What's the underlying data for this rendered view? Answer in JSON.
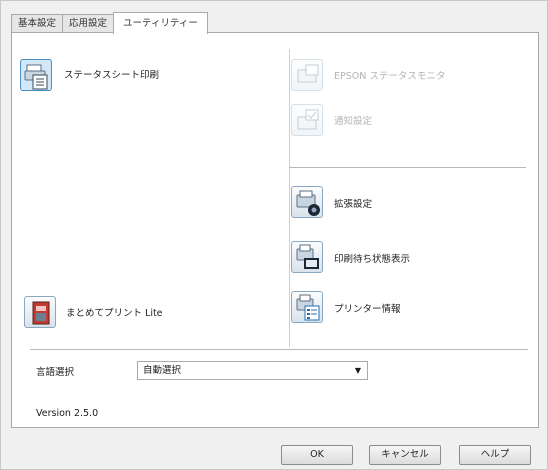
{
  "tabs": [
    {
      "label": "基本設定"
    },
    {
      "label": "応用設定"
    },
    {
      "label": "ユーティリティー"
    }
  ],
  "left_items": {
    "status_sheet": {
      "label": "ステータスシート印刷",
      "icon": "status-sheet-icon"
    },
    "matomete": {
      "label": "まとめてプリント Lite",
      "icon": "matomete-print-icon"
    }
  },
  "right_items": {
    "status_monitor": {
      "label": "EPSON ステータスモニタ",
      "icon": "status-monitor-icon",
      "disabled": true
    },
    "monitor_settings": {
      "label": "通知設定",
      "icon": "notify-settings-icon",
      "disabled": true
    },
    "extended": {
      "label": "拡張設定",
      "icon": "extended-settings-icon"
    },
    "print_queue": {
      "label": "印刷待ち状態表示",
      "icon": "print-queue-icon"
    },
    "printer_info": {
      "label": "プリンター情報",
      "icon": "printer-info-icon"
    }
  },
  "language": {
    "label": "言語選択",
    "selected": "自動選択"
  },
  "version": "Version 2.5.0",
  "buttons": {
    "ok": "OK",
    "cancel": "キャンセル",
    "help": "ヘルプ"
  }
}
